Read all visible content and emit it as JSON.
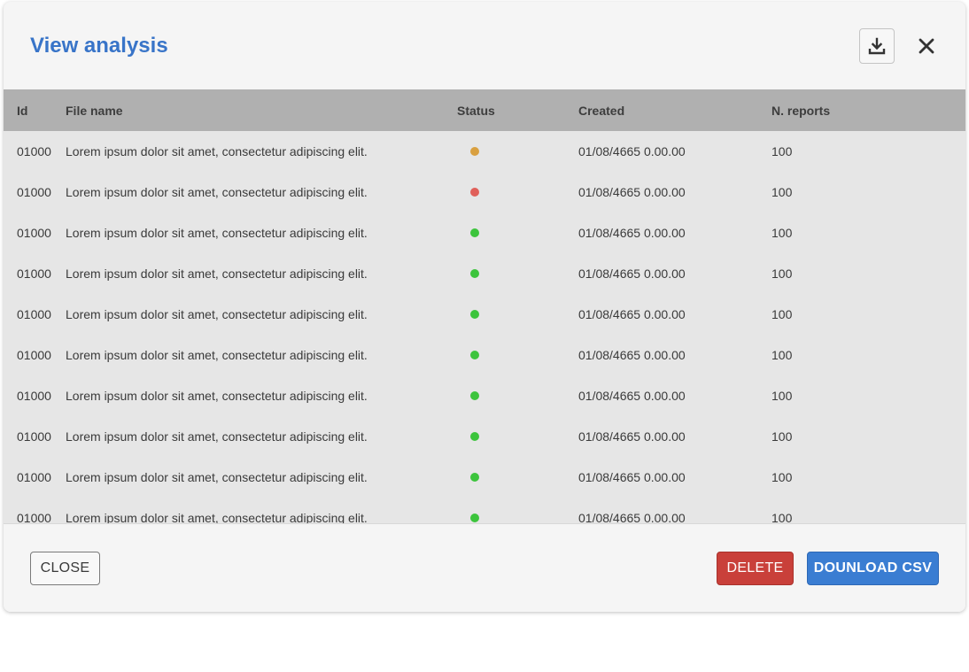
{
  "dialog": {
    "title": "View analysis",
    "download_icon": "download-icon",
    "close_icon": "close-icon"
  },
  "table": {
    "headers": [
      "Id",
      "File name",
      "Status",
      "Created",
      "N. reports"
    ],
    "rows": [
      {
        "id": "01000",
        "file": "Lorem ipsum dolor sit amet, consectetur adipiscing elit.",
        "status_color": "#d9a040",
        "created": "01/08/4665 0.00.00",
        "reports": "100"
      },
      {
        "id": "01000",
        "file": "Lorem ipsum dolor sit amet, consectetur adipiscing elit.",
        "status_color": "#e0605a",
        "created": "01/08/4665 0.00.00",
        "reports": "100"
      },
      {
        "id": "01000",
        "file": "Lorem ipsum dolor sit amet, consectetur adipiscing elit.",
        "status_color": "#3cc43c",
        "created": "01/08/4665 0.00.00",
        "reports": "100"
      },
      {
        "id": "01000",
        "file": "Lorem ipsum dolor sit amet, consectetur adipiscing elit.",
        "status_color": "#3cc43c",
        "created": "01/08/4665 0.00.00",
        "reports": "100"
      },
      {
        "id": "01000",
        "file": "Lorem ipsum dolor sit amet, consectetur adipiscing elit.",
        "status_color": "#3cc43c",
        "created": "01/08/4665 0.00.00",
        "reports": "100"
      },
      {
        "id": "01000",
        "file": "Lorem ipsum dolor sit amet, consectetur adipiscing elit.",
        "status_color": "#3cc43c",
        "created": "01/08/4665 0.00.00",
        "reports": "100"
      },
      {
        "id": "01000",
        "file": "Lorem ipsum dolor sit amet, consectetur adipiscing elit.",
        "status_color": "#3cc43c",
        "created": "01/08/4665 0.00.00",
        "reports": "100"
      },
      {
        "id": "01000",
        "file": "Lorem ipsum dolor sit amet, consectetur adipiscing elit.",
        "status_color": "#3cc43c",
        "created": "01/08/4665 0.00.00",
        "reports": "100"
      },
      {
        "id": "01000",
        "file": "Lorem ipsum dolor sit amet, consectetur adipiscing elit.",
        "status_color": "#3cc43c",
        "created": "01/08/4665 0.00.00",
        "reports": "100"
      },
      {
        "id": "01000",
        "file": "Lorem ipsum dolor sit amet, consectetur adipiscing elit.",
        "status_color": "#3cc43c",
        "created": "01/08/4665 0.00.00",
        "reports": "100"
      }
    ]
  },
  "footer": {
    "close_label": "CLOSE",
    "delete_label": "DELETE",
    "download_csv_label": "DOUNLOAD CSV"
  },
  "colors": {
    "title": "#3874c8",
    "delete": "#c9403a",
    "primary": "#3a7dd2",
    "header_bg": "#b0b0b0",
    "table_bg": "#e6e6e6"
  }
}
